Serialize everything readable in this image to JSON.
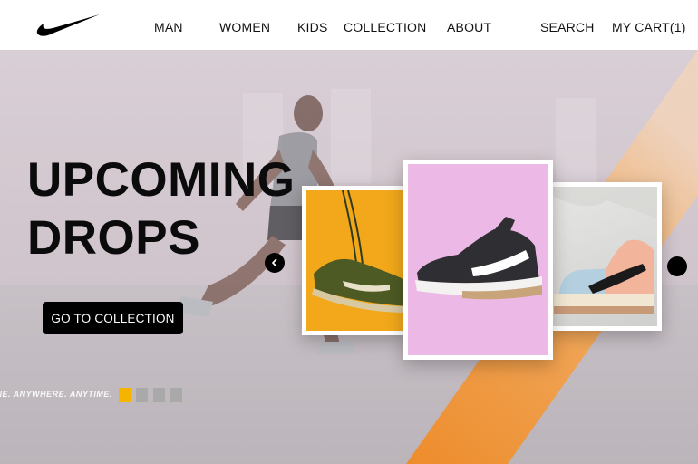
{
  "header": {
    "logo": "nike-swoosh-logo",
    "nav": {
      "man": "MAN",
      "women": "WOMEN",
      "kids": "KIDS",
      "collection": "COLLECTION",
      "about": "ABOUT",
      "search": "SEARCH",
      "cart": "MY CART(1)"
    }
  },
  "hero": {
    "headline_line1": "UPCOMING",
    "headline_line2": "DROPS",
    "cta_label": "GO TO COLLECTION",
    "tagline": "ONE. ANYWHERE. ANYTIME.",
    "pagination": {
      "total": 4,
      "active": 1
    }
  },
  "carousel": {
    "cards": [
      {
        "name": "green-running-shoe",
        "background": "#f2a81a"
      },
      {
        "name": "black-training-shoe",
        "background": "#ecb9e6"
      },
      {
        "name": "pastel-high-top-sneaker",
        "background": "#dcdcdc"
      }
    ],
    "prev_icon": "chevron-left-icon",
    "next_icon": "dot-icon"
  },
  "colors": {
    "accent_orange": "#f08a24",
    "active_dot": "#f5b400",
    "button_bg": "#000000"
  }
}
